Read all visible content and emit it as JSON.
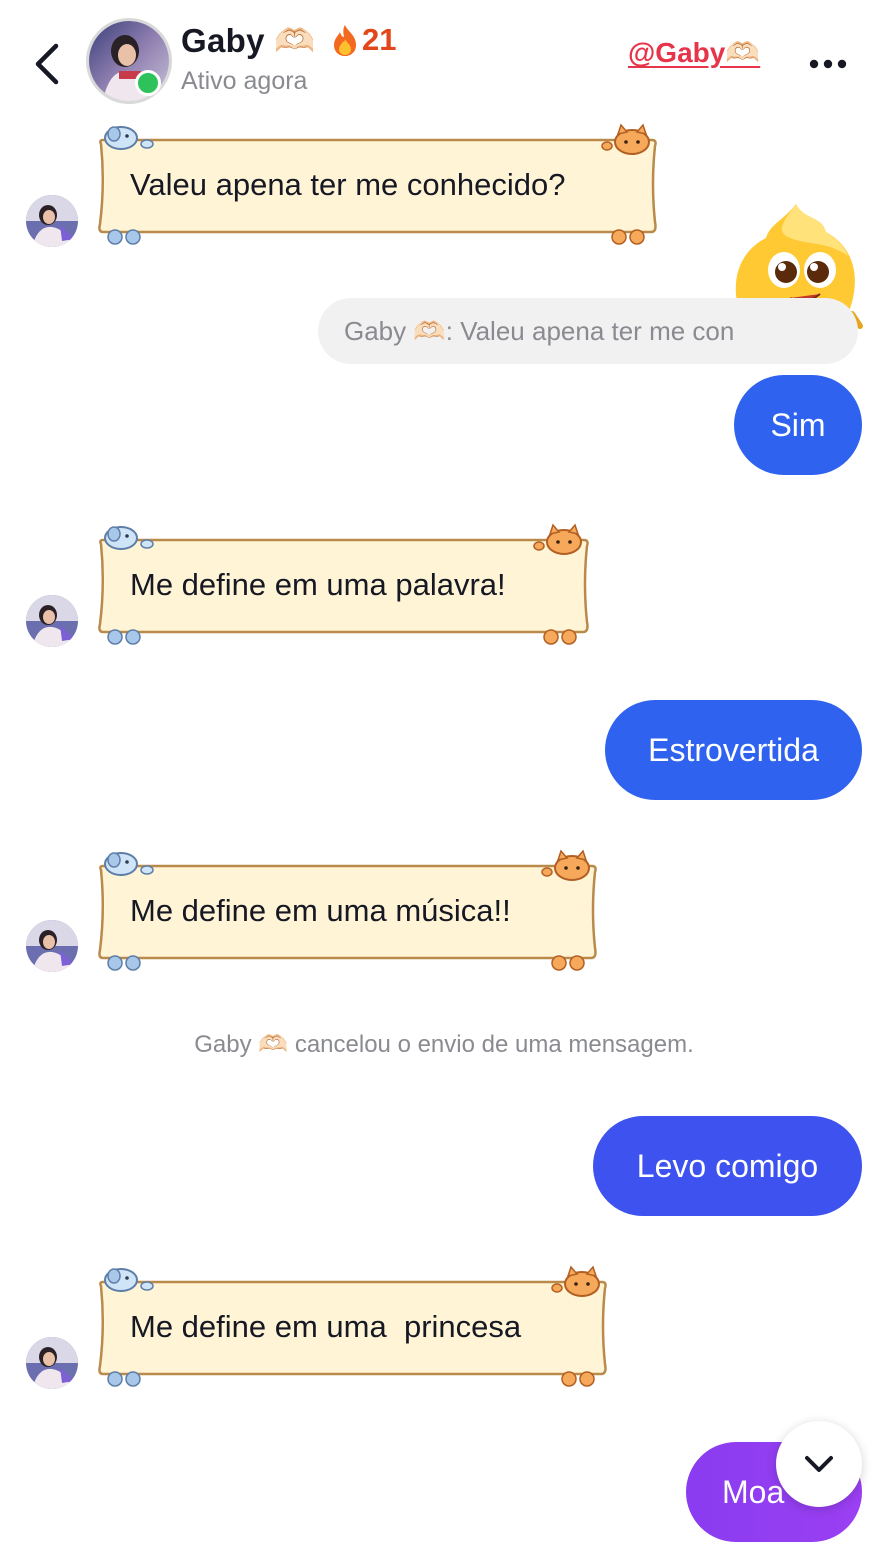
{
  "header": {
    "contact_name": "Gaby",
    "name_emoji": "🫶🏻",
    "streak_icon": "fire-icon",
    "streak_count": "21",
    "status": "Ativo agora",
    "watermark": "@Gaby🫶🏻"
  },
  "messages": [
    {
      "direction": "incoming",
      "text": "Valeu apena ter me conhecido?"
    },
    {
      "direction": "quote",
      "text": "Gaby 🫶🏻: Valeu apena ter me con"
    },
    {
      "direction": "outgoing",
      "text": "Sim"
    },
    {
      "direction": "incoming",
      "text": "Me define em uma palavra!"
    },
    {
      "direction": "outgoing",
      "text": "Estrovertida"
    },
    {
      "direction": "incoming",
      "text": "Me define em uma música!!"
    },
    {
      "direction": "system",
      "text": "Gaby 🫶🏻 cancelou o envio de uma mensagem."
    },
    {
      "direction": "outgoing",
      "text": "Levo comigo"
    },
    {
      "direction": "incoming",
      "text": "Me define em uma  princesa"
    },
    {
      "direction": "outgoing",
      "text": "Moa"
    }
  ],
  "icons": {
    "back": "chevron-left-icon",
    "more": "more-horizontal-icon",
    "scroll_down": "chevron-down-icon",
    "online": "online-status-dot"
  },
  "colors": {
    "online": "#2ec25b",
    "streak": "#e2471c",
    "watermark": "#e6354a",
    "bubble_blue": "#2f63ef",
    "bubble_indigo": "#3d52ee",
    "bubble_purple": "#8a3cf0",
    "incoming_bg": "#fff4d6",
    "incoming_border": "#b98a4a"
  }
}
